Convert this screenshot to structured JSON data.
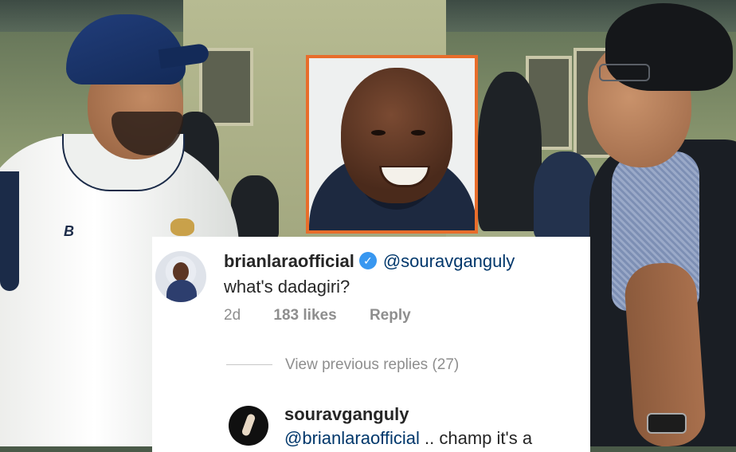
{
  "comment": {
    "username": "brianlaraofficial",
    "verified_icon": "verified-badge-icon",
    "mention": "@souravganguly",
    "text": "what's dadagiri?",
    "age": "2d",
    "likes": "183 likes",
    "reply_label": "Reply"
  },
  "thread": {
    "view_replies": "View previous replies (27)"
  },
  "reply": {
    "username": "souravganguly",
    "text_mention": "@brianlaraofficial",
    "text_rest": " .. champ it's a"
  },
  "colors": {
    "inset_border": "#e86d2b",
    "mention": "#00376b",
    "verified": "#3897f0",
    "muted": "#8e8e8e"
  }
}
